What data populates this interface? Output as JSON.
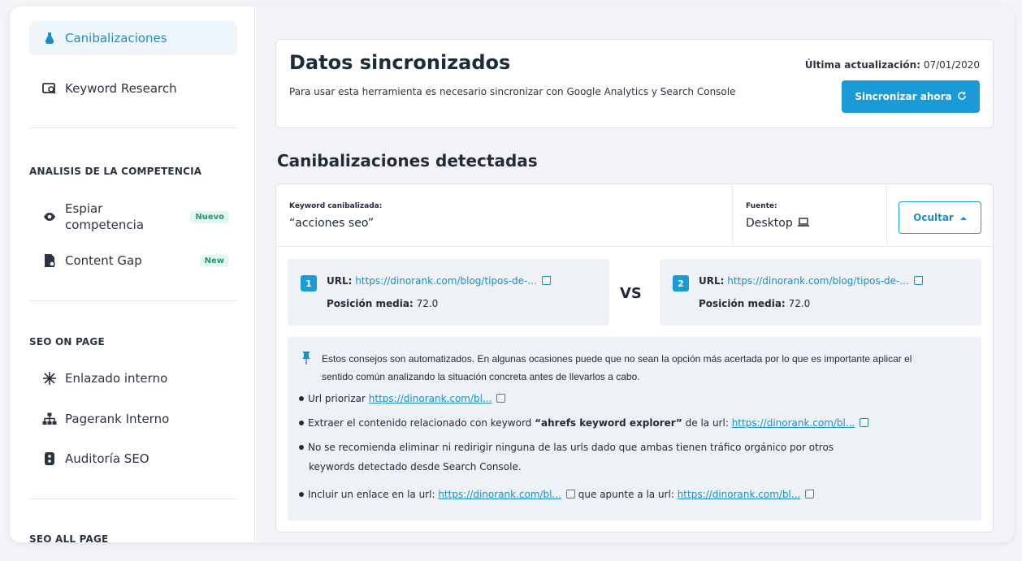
{
  "sidebar": {
    "top_items": [
      {
        "label": "Canibalizaciones",
        "icon": "flask-icon"
      },
      {
        "label": "Keyword Research",
        "icon": "keyword-search-icon"
      }
    ],
    "sections": [
      {
        "title": "ANALISIS DE LA COMPETENCIA",
        "items": [
          {
            "label": "Espiar competencia",
            "badge": "Nuevo",
            "icon": "eye-icon"
          },
          {
            "label": "Content Gap",
            "badge": "New",
            "icon": "document-icon"
          }
        ]
      },
      {
        "title": "SEO ON PAGE",
        "items": [
          {
            "label": "Enlazado interno",
            "icon": "network-icon"
          },
          {
            "label": "Pagerank Interno",
            "icon": "sitemap-icon"
          },
          {
            "label": "Auditoría SEO",
            "icon": "audit-icon"
          }
        ]
      },
      {
        "title": "SEO ALL PAGE"
      }
    ]
  },
  "sync": {
    "title": "Datos sincronizados",
    "description": "Para usar esta herramienta es necesario sincronizar con Google Analytics y Search Console",
    "last_update_label": "Última actualización:",
    "last_update_value": "07/01/2020",
    "button_label": "Sincronizar ahora"
  },
  "cannibalizations": {
    "section_title": "Canibalizaciones detectadas",
    "keyword_label": "Keyword canibalizada:",
    "keyword_value": "“acciones seo”",
    "source_label": "Fuente:",
    "source_value": "Desktop",
    "hide_button": "Ocultar",
    "vs_label": "VS",
    "urls": [
      {
        "number": "1",
        "url_label": "URL:",
        "url": "https://dinorank.com/blog/tipos-de-...",
        "position_label": "Posición media:",
        "position": "72.0"
      },
      {
        "number": "2",
        "url_label": "URL:",
        "url": "https://dinorank.com/blog/tipos-de-...",
        "position_label": "Posición media:",
        "position": "72.0"
      }
    ],
    "note": "Estos consejos son automatizados. En algunas ocasiones puede que no sean la opción más acertada por lo que es importante aplicar el sentido común analizando la situación concreta antes de llevarlos a cabo.",
    "tips": {
      "t1_text": "Url priorizar",
      "t1_link": "https://dinorank.com/bl...",
      "t2_text_a": "Extraer el contenido relacionado con keyword",
      "t2_keyword": "“ahrefs keyword explorer”",
      "t2_text_b": "de la url:",
      "t2_link": "https://dinorank.com/bl...",
      "t3_line1": "No se recomienda eliminar ni redirigir ninguna de las urls dado  que ambas tienen tráfico orgánico por otros",
      "t3_line2": "keywords detectado desde Search Console.",
      "t4_text_a": "Incluir un enlace en la url:",
      "t4_link_a": "https://dinorank.com/bl...",
      "t4_text_b": "que apunte a la url:",
      "t4_link_b": "https://dinorank.com/bl..."
    }
  },
  "colors": {
    "accent": "#1a9ad6",
    "badge_bg": "#e2f7ef",
    "badge_text": "#1f9a6e"
  }
}
